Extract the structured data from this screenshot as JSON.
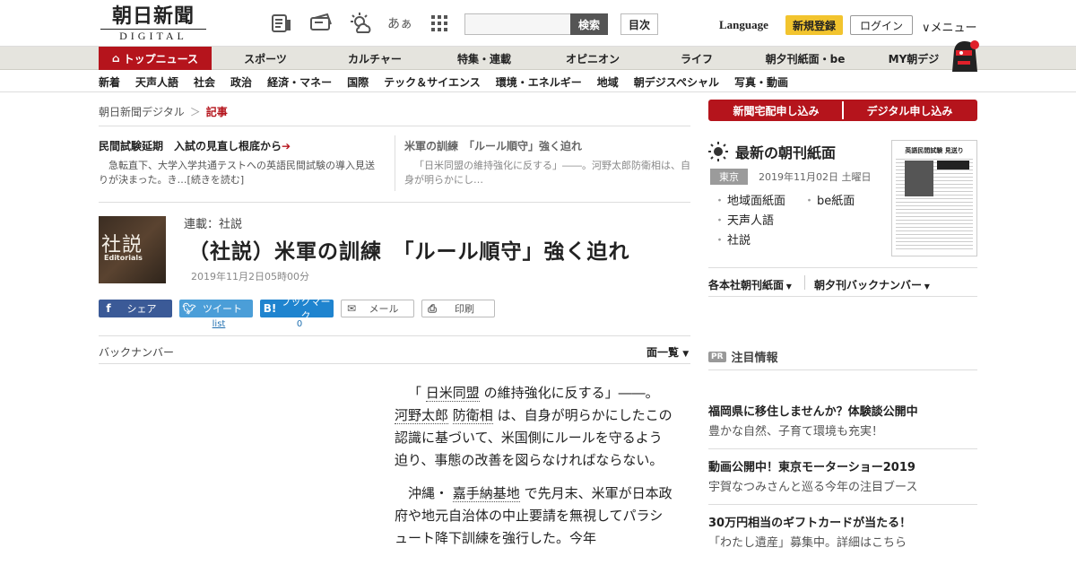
{
  "header": {
    "logo_jp": "朝日新聞",
    "logo_en": "DIGITAL",
    "icon_kana": "あぁ",
    "search_button": "検索",
    "search_placeholder": "",
    "mokuji": "目次",
    "language": "Language",
    "signup": "新規登録",
    "login": "ログイン",
    "menu": "メニュー"
  },
  "nav_main": [
    "トップニュース",
    "スポーツ",
    "カルチャー",
    "特集・連載",
    "オピニオン",
    "ライフ",
    "朝夕刊紙面・be",
    "MY朝デジ"
  ],
  "nav_sub": [
    "新着",
    "天声人語",
    "社会",
    "政治",
    "経済・マネー",
    "国際",
    "テック＆サイエンス",
    "環境・エネルギー",
    "地域",
    "朝デジスペシャル",
    "写真・動画"
  ],
  "breadcrumb": {
    "home": "朝日新聞デジタル",
    "sep": "＞",
    "current": "記事"
  },
  "teasers": [
    {
      "title": "民間試験延期　入試の見直し根底から",
      "arrow": "➔",
      "body": "急転直下、大学入学共通テストへの英語民間試験の導入見送りが決まった。き…[続きを読む]"
    },
    {
      "title": "米軍の訓練　「ルール順守」強く迫れ",
      "body": "「日米同盟の維持強化に反する」――。河野太郎防衛相は、自身が明らかにし…"
    }
  ],
  "article": {
    "thumb_kanji": "社説",
    "thumb_en": "Editorials",
    "series": "連載：社説",
    "title": "（社説）米軍の訓練　「ルール順守」強く迫れ",
    "date": "2019年11月2日05時00分",
    "share": {
      "facebook": "シェア",
      "twitter": "ツイート",
      "hatena": "ブックマーク",
      "mail": "メール",
      "print": "印刷",
      "twitter_count": "list",
      "hatena_count": "0"
    },
    "backnumber": "バックナンバー",
    "menichiran": "面一覧",
    "p1": {
      "a": "「",
      "l1": "日米同盟",
      "b": "の維持強化に反する」――。",
      "l2": "河野太郎",
      "l3": "防衛相",
      "c": "は、自身が明らかにしたこの認識に基づいて、米国側にルールを守るよう迫り、事態の改善を図らなければならない。"
    },
    "p2": {
      "a": "沖縄・",
      "l1": "嘉手納基地",
      "b": "で先月末、米軍が日本政府や地元自治体の中止要請を無視してパラシュート降下訓練を強行した。今年"
    }
  },
  "sidebar": {
    "apply_home": "新聞宅配申し込み",
    "apply_digital": "デジタル申し込み",
    "morning_title": "最新の朝刊紙面",
    "pref": "東京",
    "paper_date": "2019年11月02日 土曜日",
    "links": [
      "地域面紙面",
      "be紙面",
      "天声人語",
      "社説"
    ],
    "paper_headline": "英語民間試験 見送り",
    "dropdown_1": "各本社朝刊紙面",
    "dropdown_2": "朝夕刊バックナンバー",
    "pr_tag": "PR",
    "pr_title": "注目情報",
    "pr_items": [
      {
        "title": "福岡県に移住しませんか？体験談公開中",
        "sub": "豊かな自然、子育て環境も充実！"
      },
      {
        "title": "動画公開中！東京モーターショー2019",
        "sub": "宇賀なつみさんと巡る今年の注目ブース"
      },
      {
        "title": "30万円相当のギフトカードが当たる！",
        "sub": "「わたし遺産」募集中。詳細はこちら"
      }
    ]
  },
  "colors": {
    "brand_red": "#b5141c",
    "signup_yellow": "#f2c42e",
    "facebook": "#3b5a97",
    "twitter": "#4b9ed8",
    "hatena": "#1f84cf"
  }
}
